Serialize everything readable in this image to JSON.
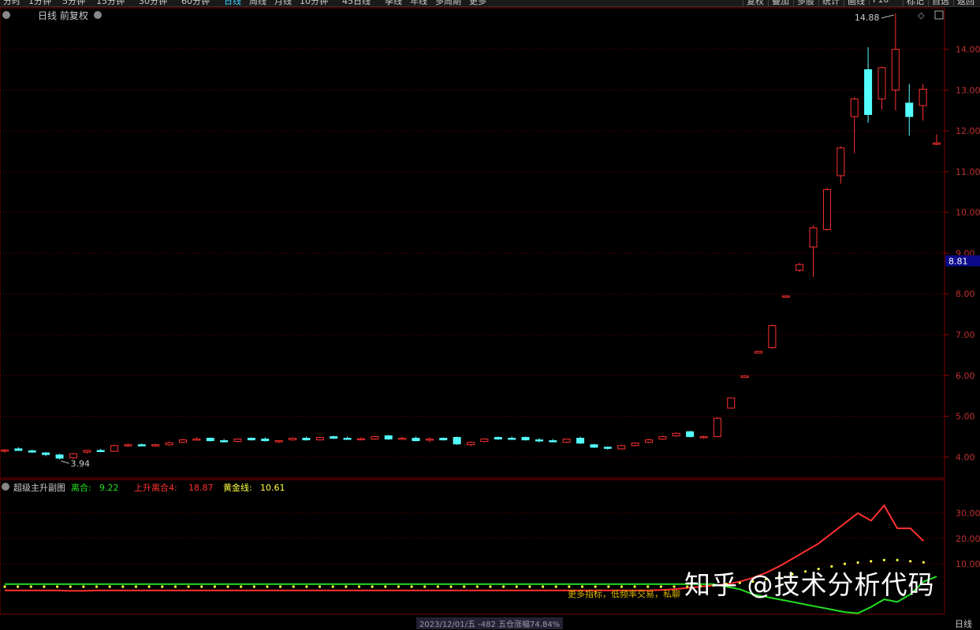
{
  "toolbar": {
    "periods": [
      "分时",
      "1分钟",
      "5分钟",
      "15分钟",
      "30分钟",
      "60分钟",
      "日线",
      "周线",
      "月线",
      "10分钟",
      "45日线",
      "季线",
      "年线",
      "多周期",
      "更多"
    ],
    "active_period": "日线",
    "right_buttons": [
      "复权",
      "叠加",
      "多股",
      "统计",
      "画线",
      "F10",
      "标记",
      "自选",
      "返回"
    ]
  },
  "main_chart": {
    "title": "日线 前复权",
    "high_marker": "14.88",
    "low_marker": "3.94",
    "current_price": "8.81",
    "y_ticks": [
      "14.00",
      "13.00",
      "12.00",
      "11.00",
      "10.00",
      "9.00",
      "8.00",
      "7.00",
      "6.00",
      "5.00",
      "4.00"
    ]
  },
  "sub_chart": {
    "indicator_name": "超级主升副图",
    "legend": [
      {
        "label": "离合: ",
        "value": "9.22",
        "color": "#22e022"
      },
      {
        "label": "上升离合4: ",
        "value": "18.87",
        "color": "#ff3030"
      },
      {
        "label": "黄金线: ",
        "value": "10.61",
        "color": "#ffff40"
      }
    ],
    "y_ticks": [
      "30.00",
      "20.00",
      "10.00"
    ],
    "note": "更多指标，低频率交易，私聊"
  },
  "watermark": "知乎 @技术分析代码",
  "bottom_bar": {
    "label": "2023/12/01/五 -482 五仓涨幅74.84%",
    "right": "日线"
  },
  "colors": {
    "up": "#ff3030",
    "down": "#54ffff",
    "bg": "#000000",
    "grid": "#7a0000"
  },
  "chart_data": [
    {
      "type": "candlestick",
      "title": "日线 前复权",
      "ylim": [
        3.6,
        14.9
      ],
      "candles": [
        {
          "o": 4.15,
          "h": 4.2,
          "l": 4.1,
          "c": 4.17
        },
        {
          "o": 4.2,
          "h": 4.24,
          "l": 4.15,
          "c": 4.16
        },
        {
          "o": 4.15,
          "h": 4.18,
          "l": 4.1,
          "c": 4.12
        },
        {
          "o": 4.1,
          "h": 4.12,
          "l": 4.02,
          "c": 4.06
        },
        {
          "o": 4.05,
          "h": 4.08,
          "l": 3.94,
          "c": 3.97
        },
        {
          "o": 3.98,
          "h": 4.1,
          "l": 3.95,
          "c": 4.08
        },
        {
          "o": 4.12,
          "h": 4.18,
          "l": 4.08,
          "c": 4.16
        },
        {
          "o": 4.16,
          "h": 4.2,
          "l": 4.12,
          "c": 4.14
        },
        {
          "o": 4.14,
          "h": 4.3,
          "l": 4.12,
          "c": 4.28
        },
        {
          "o": 4.28,
          "h": 4.33,
          "l": 4.25,
          "c": 4.3
        },
        {
          "o": 4.3,
          "h": 4.33,
          "l": 4.27,
          "c": 4.29
        },
        {
          "o": 4.29,
          "h": 4.32,
          "l": 4.25,
          "c": 4.3
        },
        {
          "o": 4.3,
          "h": 4.38,
          "l": 4.28,
          "c": 4.35
        },
        {
          "o": 4.36,
          "h": 4.44,
          "l": 4.34,
          "c": 4.42
        },
        {
          "o": 4.44,
          "h": 4.48,
          "l": 4.4,
          "c": 4.44
        },
        {
          "o": 4.46,
          "h": 4.48,
          "l": 4.38,
          "c": 4.4
        },
        {
          "o": 4.4,
          "h": 4.44,
          "l": 4.36,
          "c": 4.38
        },
        {
          "o": 4.38,
          "h": 4.45,
          "l": 4.36,
          "c": 4.44
        },
        {
          "o": 4.46,
          "h": 4.48,
          "l": 4.4,
          "c": 4.42
        },
        {
          "o": 4.44,
          "h": 4.48,
          "l": 4.38,
          "c": 4.4
        },
        {
          "o": 4.38,
          "h": 4.42,
          "l": 4.34,
          "c": 4.4
        },
        {
          "o": 4.42,
          "h": 4.48,
          "l": 4.4,
          "c": 4.46
        },
        {
          "o": 4.46,
          "h": 4.5,
          "l": 4.4,
          "c": 4.42
        },
        {
          "o": 4.42,
          "h": 4.5,
          "l": 4.4,
          "c": 4.48
        },
        {
          "o": 4.5,
          "h": 4.52,
          "l": 4.44,
          "c": 4.46
        },
        {
          "o": 4.46,
          "h": 4.5,
          "l": 4.42,
          "c": 4.45
        },
        {
          "o": 4.45,
          "h": 4.48,
          "l": 4.42,
          "c": 4.45
        },
        {
          "o": 4.44,
          "h": 4.52,
          "l": 4.42,
          "c": 4.5
        },
        {
          "o": 4.52,
          "h": 4.54,
          "l": 4.42,
          "c": 4.44
        },
        {
          "o": 4.46,
          "h": 4.5,
          "l": 4.42,
          "c": 4.46
        },
        {
          "o": 4.46,
          "h": 4.5,
          "l": 4.38,
          "c": 4.4
        },
        {
          "o": 4.42,
          "h": 4.48,
          "l": 4.36,
          "c": 4.44
        },
        {
          "o": 4.46,
          "h": 4.48,
          "l": 4.4,
          "c": 4.42
        },
        {
          "o": 4.48,
          "h": 4.5,
          "l": 4.3,
          "c": 4.32
        },
        {
          "o": 4.3,
          "h": 4.38,
          "l": 4.26,
          "c": 4.36
        },
        {
          "o": 4.38,
          "h": 4.46,
          "l": 4.36,
          "c": 4.44
        },
        {
          "o": 4.48,
          "h": 4.5,
          "l": 4.42,
          "c": 4.44
        },
        {
          "o": 4.46,
          "h": 4.5,
          "l": 4.42,
          "c": 4.45
        },
        {
          "o": 4.48,
          "h": 4.5,
          "l": 4.4,
          "c": 4.42
        },
        {
          "o": 4.42,
          "h": 4.46,
          "l": 4.36,
          "c": 4.4
        },
        {
          "o": 4.4,
          "h": 4.44,
          "l": 4.36,
          "c": 4.38
        },
        {
          "o": 4.36,
          "h": 4.45,
          "l": 4.34,
          "c": 4.44
        },
        {
          "o": 4.46,
          "h": 4.5,
          "l": 4.32,
          "c": 4.34
        },
        {
          "o": 4.3,
          "h": 4.32,
          "l": 4.22,
          "c": 4.24
        },
        {
          "o": 4.24,
          "h": 4.26,
          "l": 4.18,
          "c": 4.22
        },
        {
          "o": 4.2,
          "h": 4.3,
          "l": 4.18,
          "c": 4.28
        },
        {
          "o": 4.28,
          "h": 4.36,
          "l": 4.26,
          "c": 4.34
        },
        {
          "o": 4.36,
          "h": 4.44,
          "l": 4.34,
          "c": 4.42
        },
        {
          "o": 4.44,
          "h": 4.52,
          "l": 4.42,
          "c": 4.5
        },
        {
          "o": 4.52,
          "h": 4.6,
          "l": 4.5,
          "c": 4.58
        },
        {
          "o": 4.62,
          "h": 4.64,
          "l": 4.48,
          "c": 4.5
        },
        {
          "o": 4.48,
          "h": 4.52,
          "l": 4.45,
          "c": 4.5
        },
        {
          "o": 4.5,
          "h": 4.98,
          "l": 4.48,
          "c": 4.95
        },
        {
          "o": 5.2,
          "h": 5.45,
          "l": 5.2,
          "c": 5.45
        },
        {
          "o": 5.95,
          "h": 5.99,
          "l": 5.95,
          "c": 5.99
        },
        {
          "o": 6.55,
          "h": 6.59,
          "l": 6.55,
          "c": 6.59
        },
        {
          "o": 6.68,
          "h": 7.25,
          "l": 6.66,
          "c": 7.22
        },
        {
          "o": 7.92,
          "h": 7.95,
          "l": 7.92,
          "c": 7.95
        },
        {
          "o": 8.58,
          "h": 8.76,
          "l": 8.54,
          "c": 8.72
        },
        {
          "o": 9.15,
          "h": 9.68,
          "l": 8.42,
          "c": 9.62
        },
        {
          "o": 9.58,
          "h": 10.6,
          "l": 9.55,
          "c": 10.56
        },
        {
          "o": 10.9,
          "h": 11.62,
          "l": 10.7,
          "c": 11.58
        },
        {
          "o": 12.35,
          "h": 12.82,
          "l": 11.45,
          "c": 12.78
        },
        {
          "o": 13.5,
          "h": 14.05,
          "l": 12.2,
          "c": 12.4
        },
        {
          "o": 12.78,
          "h": 13.58,
          "l": 12.52,
          "c": 13.55
        },
        {
          "o": 13.0,
          "h": 14.88,
          "l": 12.5,
          "c": 14.0
        },
        {
          "o": 12.68,
          "h": 13.15,
          "l": 11.88,
          "c": 12.35
        },
        {
          "o": 12.62,
          "h": 13.15,
          "l": 12.25,
          "c": 13.02
        },
        {
          "o": 11.7,
          "h": 11.92,
          "l": 11.65,
          "c": 11.7
        }
      ]
    },
    {
      "type": "line",
      "title": "超级主升副图",
      "ylim": [
        -8,
        37
      ],
      "series": [
        {
          "name": "离合",
          "color": "#22e022",
          "values": [
            2,
            2,
            2,
            2,
            2,
            2,
            2,
            2,
            2,
            2,
            2,
            2,
            2,
            2,
            2,
            2,
            2,
            2,
            2,
            2,
            2,
            2,
            2,
            2,
            2,
            2,
            2,
            2,
            2,
            2,
            2,
            2,
            2,
            2,
            2,
            2,
            2,
            2,
            2,
            2,
            2,
            2,
            2,
            2,
            2,
            2,
            2,
            2,
            2,
            2,
            2,
            2,
            2,
            2,
            2,
            1,
            0,
            -2,
            -3,
            -4,
            -5,
            -6,
            -7,
            -8,
            -9,
            -9.5,
            -7,
            -4,
            -5,
            -2,
            3,
            5
          ]
        },
        {
          "name": "上升离合4",
          "color": "#ff3030",
          "values": [
            -0.5,
            -0.5,
            -0.5,
            -0.5,
            -0.5,
            -0.6,
            -0.6,
            -0.5,
            -0.5,
            -0.5,
            -0.5,
            -0.5,
            -0.5,
            -0.5,
            -0.5,
            -0.5,
            -0.5,
            -0.5,
            -0.5,
            -0.5,
            -0.5,
            -0.5,
            -0.5,
            -0.5,
            -0.5,
            -0.5,
            -0.5,
            -0.5,
            -0.5,
            -0.5,
            -0.5,
            -0.5,
            -0.5,
            -0.5,
            -0.5,
            -0.5,
            -0.5,
            -0.5,
            -0.5,
            -0.5,
            -0.5,
            -0.5,
            -0.5,
            -0.5,
            -0.5,
            -0.5,
            -0.5,
            -0.5,
            -0.5,
            -0.5,
            -0.3,
            0,
            0.5,
            1,
            1.5,
            2,
            3,
            4.5,
            6.5,
            9,
            12,
            15,
            18,
            22,
            26,
            30,
            27,
            33,
            24,
            24,
            19
          ]
        },
        {
          "name": "黄金线",
          "color": "#ffff40",
          "values": [
            1,
            1,
            1,
            1,
            1,
            1,
            1,
            1,
            1,
            1,
            1,
            1,
            1,
            1,
            1,
            1,
            1,
            1,
            1,
            1,
            1,
            1,
            1,
            1,
            1,
            1,
            1,
            1,
            1,
            1,
            1,
            1,
            1,
            1,
            1,
            1,
            1,
            1,
            1,
            1,
            1,
            1,
            1,
            1,
            1,
            1,
            1,
            1,
            1,
            1,
            1,
            1,
            1,
            1.2,
            1.5,
            2,
            2.5,
            3,
            4,
            5,
            6,
            7,
            8,
            9,
            10,
            10.5,
            11,
            11.5,
            11.5,
            11,
            10.6
          ]
        }
      ]
    }
  ]
}
